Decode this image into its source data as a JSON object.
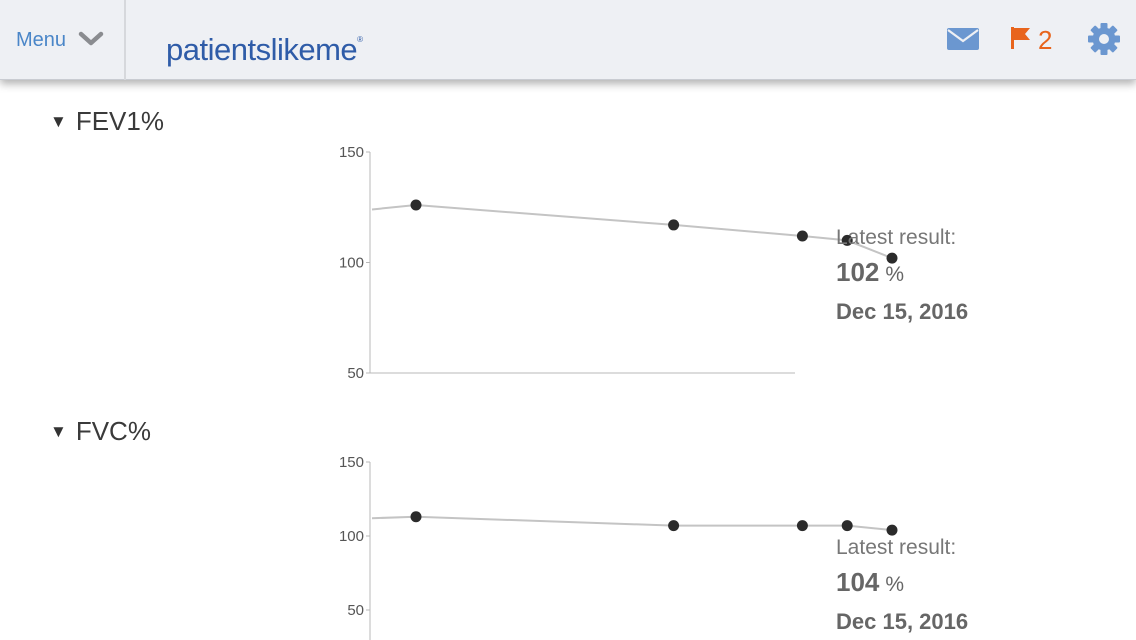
{
  "header": {
    "menu_label": "Menu",
    "logo": {
      "part1": "patients",
      "part2": "like",
      "part3": "me",
      "mark": "®"
    },
    "flag_count": "2",
    "icons": {
      "menu": "chevron-down-icon",
      "mail": "mail-icon",
      "flag": "flag-icon",
      "settings": "gear-icon"
    },
    "colors": {
      "accent": "#4a86c8",
      "logo": "#2f5ca8",
      "flag": "#e8641c",
      "icon": "#6b97d0"
    }
  },
  "sections": [
    {
      "title": "FEV1%",
      "latest": {
        "label": "Latest result:",
        "value": "102",
        "unit": "%",
        "date": "Dec 15, 2016"
      }
    },
    {
      "title": "FVC%",
      "latest": {
        "label": "Latest result:",
        "value": "104",
        "unit": "%",
        "date": "Dec 15, 2016"
      }
    }
  ],
  "chart_data": [
    {
      "type": "line",
      "yticks": [
        "150",
        "100",
        "50"
      ],
      "ylim": [
        50,
        150
      ],
      "x": [
        0.0,
        0.46,
        0.69,
        0.77,
        0.85
      ],
      "values": [
        126,
        117,
        112,
        110,
        102
      ],
      "line_extends_left_to": 124,
      "grid": false,
      "colors": {
        "line": "#c4c4c4",
        "point": "#2b2b2b",
        "axis": "#b8b8b8"
      }
    },
    {
      "type": "line",
      "yticks": [
        "150",
        "100",
        "50"
      ],
      "ylim": [
        50,
        150
      ],
      "x": [
        0.0,
        0.46,
        0.69,
        0.77,
        0.85
      ],
      "values": [
        113,
        107,
        107,
        107,
        104
      ],
      "line_extends_left_to": 112,
      "grid": false,
      "colors": {
        "line": "#c4c4c4",
        "point": "#2b2b2b",
        "axis": "#b8b8b8"
      }
    }
  ]
}
